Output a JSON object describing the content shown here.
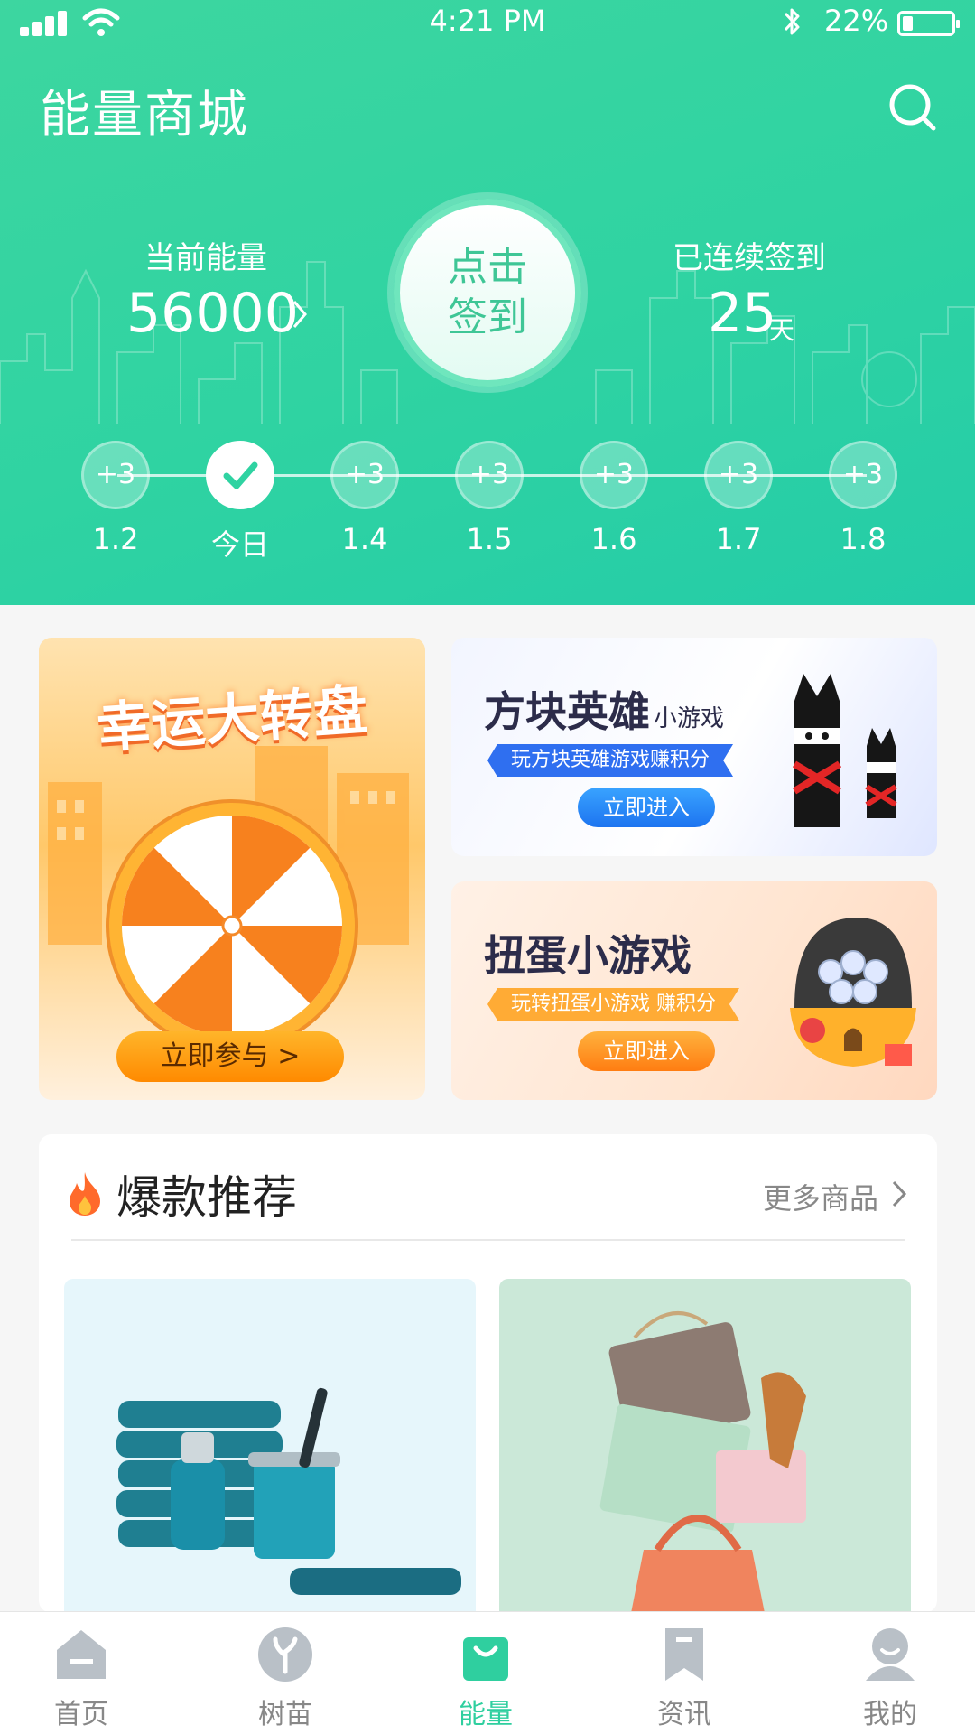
{
  "status_bar": {
    "time": "4:21 PM",
    "battery": "22%",
    "battery_level": 0.22
  },
  "header": {
    "title": "能量商城"
  },
  "energy": {
    "label": "当前能量",
    "value": "56000"
  },
  "checkin": {
    "label": "点击签到"
  },
  "streak": {
    "label": "已连续签到",
    "days": "25",
    "unit": "天"
  },
  "days": [
    {
      "reward": "+3",
      "date": "1.2",
      "checked": false
    },
    {
      "reward": "",
      "date": "今日",
      "checked": true
    },
    {
      "reward": "+3",
      "date": "1.4",
      "checked": false
    },
    {
      "reward": "+3",
      "date": "1.5",
      "checked": false
    },
    {
      "reward": "+3",
      "date": "1.6",
      "checked": false
    },
    {
      "reward": "+3",
      "date": "1.7",
      "checked": false
    },
    {
      "reward": "+3",
      "date": "1.8",
      "checked": false
    }
  ],
  "promos": {
    "wheel": {
      "title": "幸运大转盘",
      "cta": "立即参与 >"
    },
    "hero": {
      "title": "方块英雄",
      "title_suffix": "小游戏",
      "subtitle": "玩方块英雄游戏赚积分",
      "cta": "立即进入"
    },
    "gacha": {
      "title": "扭蛋小游戏",
      "subtitle": "玩转扭蛋小游戏 赚积分",
      "cta": "立即进入"
    }
  },
  "hot": {
    "title": "爆款推荐",
    "more": "更多商品"
  },
  "tabs": [
    {
      "label": "首页",
      "icon": "home-icon"
    },
    {
      "label": "树苗",
      "icon": "sapling-icon"
    },
    {
      "label": "能量",
      "icon": "shopping-bag-icon",
      "active": true
    },
    {
      "label": "资讯",
      "icon": "bookmark-icon"
    },
    {
      "label": "我的",
      "icon": "profile-icon"
    }
  ],
  "colors": {
    "brand": "#2fd3a2",
    "tab_active": "#2fcf9f",
    "tab_inactive": "#b9c0c7"
  }
}
